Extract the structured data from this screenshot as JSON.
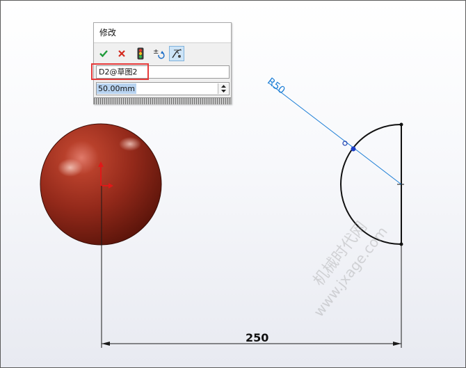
{
  "dialog": {
    "title": "修改",
    "tools": [
      {
        "icon": "check-icon",
        "color": "#1f9b3a"
      },
      {
        "icon": "close-icon",
        "color": "#d42a1f"
      },
      {
        "icon": "traffic-light-icon"
      },
      {
        "icon": "plus-minus-reverse-icon"
      },
      {
        "icon": "dimension-mark-icon"
      }
    ],
    "name_value": "D2@草图2",
    "dimension_value": "50.00mm"
  },
  "sketch": {
    "radius_label": "R50",
    "distance_label": "250",
    "sphere_color": "#8b2314",
    "dim_line_color": "#1e7fd6",
    "highlight_color": "#e53a3a"
  },
  "watermark": {
    "line1": "机械时代网",
    "line2": "www.jxage.com"
  }
}
